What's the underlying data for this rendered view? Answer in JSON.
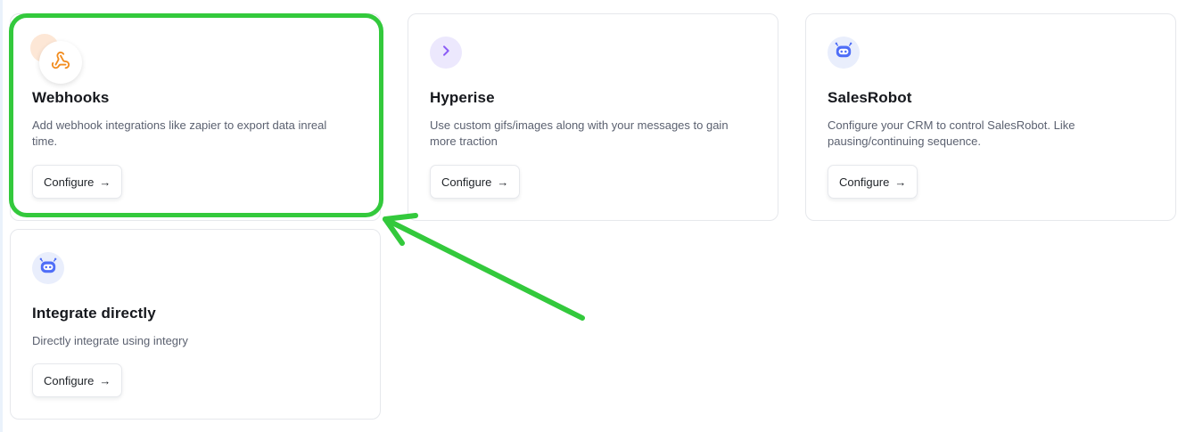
{
  "cards": [
    {
      "title": "Webhooks",
      "description": "Add webhook integrations like zapier to export data inreal time.",
      "button_label": "Configure",
      "button_arrow": "→",
      "icon": "webhook-icon",
      "icon_color": "#f28c1e"
    },
    {
      "title": "Hyperise",
      "description": "Use custom gifs/images along with your messages to gain more traction",
      "button_label": "Configure",
      "button_arrow": "→",
      "icon": "chevron-right-icon",
      "icon_color": "#8b5cf6"
    },
    {
      "title": "SalesRobot",
      "description": "Configure your CRM to control SalesRobot. Like pausing/continuing sequence.",
      "button_label": "Configure",
      "button_arrow": "→",
      "icon": "robot-icon",
      "icon_color": "#4f6ef7"
    },
    {
      "title": "Integrate directly",
      "description": "Directly integrate using integry",
      "button_label": "Configure",
      "button_arrow": "→",
      "icon": "robot-icon",
      "icon_color": "#4f6ef7"
    }
  ],
  "annotation": {
    "highlight_color": "#33c93c",
    "arrow_color": "#33c93c"
  }
}
